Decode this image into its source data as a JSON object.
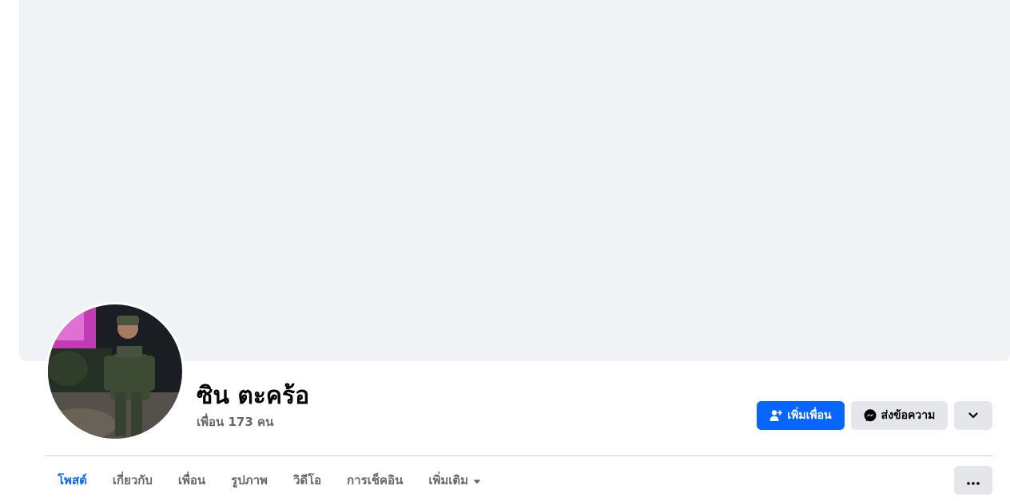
{
  "profile": {
    "name": "ซิน ตะคร้อ",
    "friends_count": "เพื่อน 173 คน"
  },
  "actions": {
    "add_friend_label": "เพิ่มเพื่อน",
    "message_label": "ส่งข้อความ"
  },
  "tabs": [
    {
      "label": "โพสต์",
      "active": true
    },
    {
      "label": "เกี่ยวกับ",
      "active": false
    },
    {
      "label": "เพื่อน",
      "active": false
    },
    {
      "label": "รูปภาพ",
      "active": false
    },
    {
      "label": "วิดีโอ",
      "active": false
    },
    {
      "label": "การเช็คอิน",
      "active": false
    },
    {
      "label": "เพิ่มเติม",
      "active": false
    }
  ],
  "icons": {
    "add_friend": "person-plus-icon",
    "message": "messenger-icon",
    "expand": "chevron-down-icon",
    "more_tabs": "caret-down-icon",
    "overflow": "ellipsis-icon"
  },
  "colors": {
    "accent": "#0866ff",
    "cover_bg": "#f0f2f5",
    "secondary_button": "#e4e6eb",
    "muted_text": "#65676b"
  }
}
